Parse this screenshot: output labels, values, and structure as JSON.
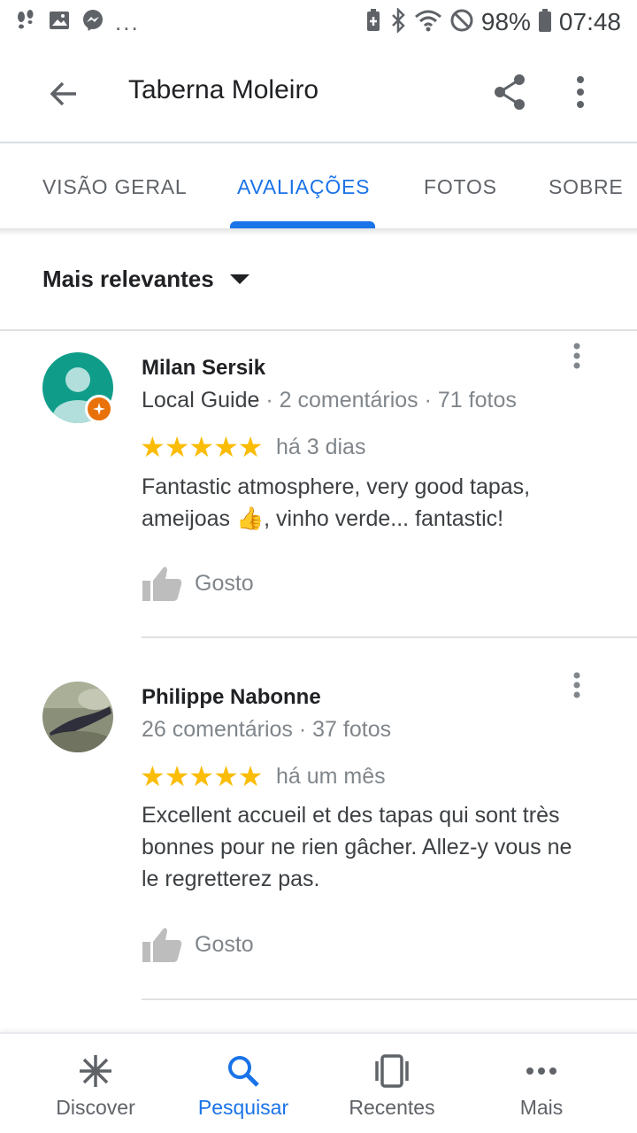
{
  "status_bar": {
    "battery": "98%",
    "time": "07:48",
    "more_notifications": "..."
  },
  "app_bar": {
    "title": "Taberna Moleiro"
  },
  "tabs": [
    {
      "label": "VISÃO GERAL",
      "active": false
    },
    {
      "label": "AVALIAÇÕES",
      "active": true
    },
    {
      "label": "FOTOS",
      "active": false
    },
    {
      "label": "SOBRE",
      "active": false
    }
  ],
  "sort": {
    "label": "Mais relevantes"
  },
  "reviews": [
    {
      "name": "Milan Sersik",
      "badge": "Local Guide",
      "meta": "2 comentários · 71 fotos",
      "stars": "★★★★★",
      "rating": 5,
      "when": "há 3 dias",
      "text_line1": "Fantastic atmosphere, very good tapas,",
      "text_line2_a": "ameijoas ",
      "text_emoji": "👍",
      "text_line2_b": ", vinho verde... fantastic!",
      "like_label": "Gosto"
    },
    {
      "name": "Philippe Nabonne",
      "meta": "26 comentários · 37 fotos",
      "stars": "★★★★★",
      "rating": 5,
      "when": "há um mês",
      "text_line1": "Excellent accueil et des tapas qui sont très",
      "text_line2": "bonnes pour ne rien gâcher. Allez-y vous ne",
      "text_line3": "le regretterez pas.",
      "like_label": "Gosto"
    }
  ],
  "bottom_nav": [
    {
      "label": "Discover",
      "icon": "asterisk-icon",
      "active": false
    },
    {
      "label": "Pesquisar",
      "icon": "search-icon",
      "active": true
    },
    {
      "label": "Recentes",
      "icon": "recents-icon",
      "active": false
    },
    {
      "label": "Mais",
      "icon": "more-horizontal-icon",
      "active": false
    }
  ],
  "colors": {
    "accent": "#1a73e8",
    "star": "#fbbc04",
    "local_guide_badge": "#e8710a",
    "avatar_teal": "#0f9d8a"
  }
}
